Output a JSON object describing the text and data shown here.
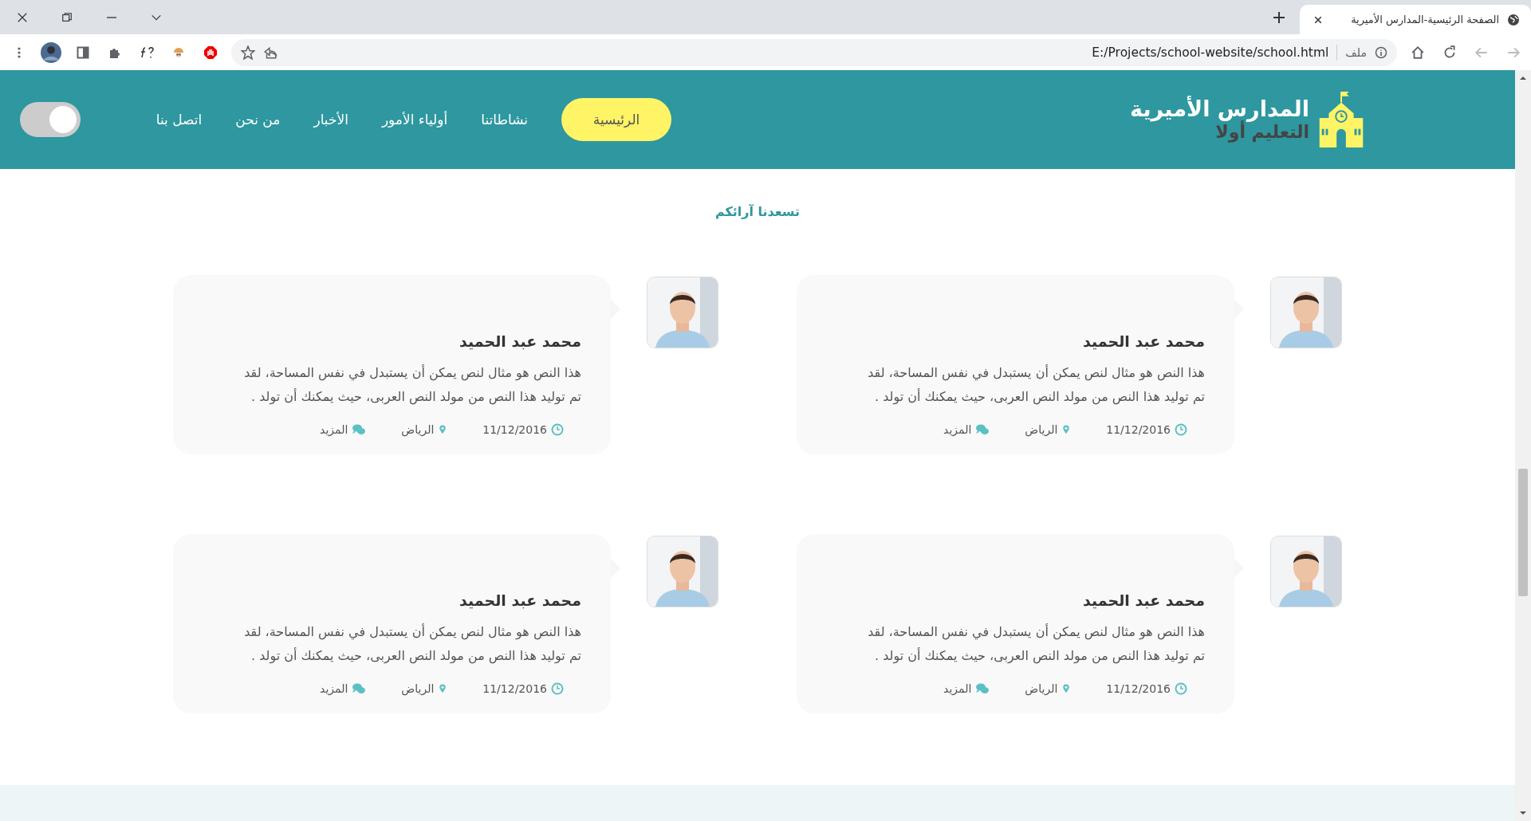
{
  "browser": {
    "tab_title": "الصفحة الرئيسية-المدارس الأميرية",
    "address_label": "ملف",
    "url": "E:/Projects/school-website/school.html"
  },
  "header": {
    "title": "المدارس الأميرية",
    "tagline": "التعليم أولا",
    "nav": [
      {
        "label": "الرئيسية",
        "selected": true
      },
      {
        "label": "نشاطاتنا",
        "selected": false
      },
      {
        "label": "أولياء الأمور",
        "selected": false
      },
      {
        "label": "الأخبار",
        "selected": false
      },
      {
        "label": "من نحن",
        "selected": false
      },
      {
        "label": "اتصل بنا",
        "selected": false
      }
    ],
    "theme_toggle": {
      "on": false
    }
  },
  "section_title": "تسعدنا آرائكم",
  "testimonials": [
    {
      "name": "محمد عبد الحميد",
      "text": "هذا النص هو مثال لنص يمكن أن يستبدل في نفس المساحة، لقد تم توليد هذا النص من مولد النص العربى، حيث يمكنك أن تولد .",
      "date": "11/12/2016",
      "location": "الرياض",
      "more": "المزيد"
    },
    {
      "name": "محمد عبد الحميد",
      "text": "هذا النص هو مثال لنص يمكن أن يستبدل في نفس المساحة، لقد تم توليد هذا النص من مولد النص العربى، حيث يمكنك أن تولد .",
      "date": "11/12/2016",
      "location": "الرياض",
      "more": "المزيد"
    },
    {
      "name": "محمد عبد الحميد",
      "text": "هذا النص هو مثال لنص يمكن أن يستبدل في نفس المساحة، لقد تم توليد هذا النص من مولد النص العربى، حيث يمكنك أن تولد .",
      "date": "11/12/2016",
      "location": "الرياض",
      "more": "المزيد"
    },
    {
      "name": "محمد عبد الحميد",
      "text": "هذا النص هو مثال لنص يمكن أن يستبدل في نفس المساحة، لقد تم توليد هذا النص من مولد النص العربى، حيث يمكنك أن تولد .",
      "date": "11/12/2016",
      "location": "الرياض",
      "more": "المزيد"
    }
  ]
}
